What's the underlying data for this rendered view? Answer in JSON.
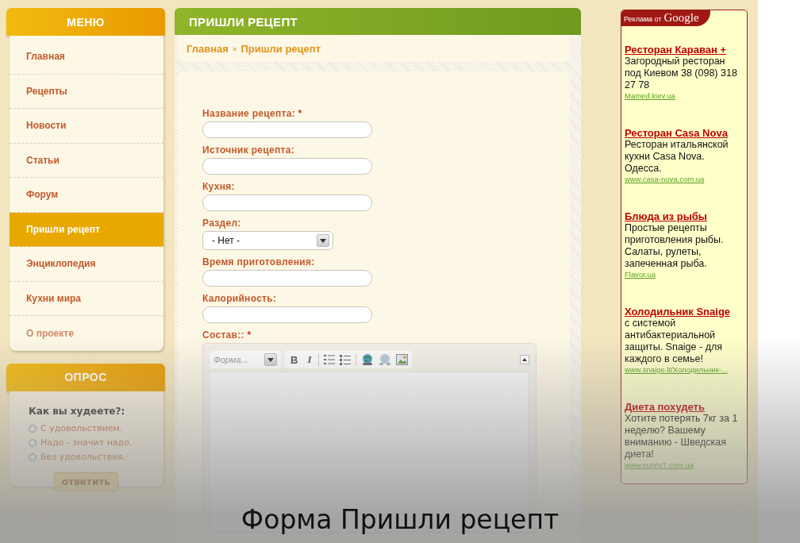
{
  "menu": {
    "title": "МЕНЮ",
    "items": [
      {
        "label": "Главная",
        "selected": false
      },
      {
        "label": "Рецепты",
        "selected": false
      },
      {
        "label": "Новости",
        "selected": false
      },
      {
        "label": "Статьи",
        "selected": false
      },
      {
        "label": "Форум",
        "selected": false
      },
      {
        "label": "Пришли рецепт",
        "selected": true
      },
      {
        "label": "Энциклопедия",
        "selected": false
      },
      {
        "label": "Кухни мира",
        "selected": false
      },
      {
        "label": "О проекте",
        "selected": false
      }
    ]
  },
  "poll": {
    "title": "ОПРОС",
    "question": "Как вы худеете?:",
    "options": [
      {
        "label": "С удовольствием.",
        "selected": false
      },
      {
        "label": "Надо - значит надо.",
        "selected": false
      },
      {
        "label": "Без удовольствия.",
        "selected": false
      }
    ],
    "button": "ответить"
  },
  "page": {
    "title": "ПРИШЛИ РЕЦЕПТ",
    "breadcrumb": [
      "Главная",
      "Пришли рецепт"
    ],
    "separator": "»"
  },
  "form": {
    "required_mark": "*",
    "fields": [
      {
        "kind": "text",
        "label": "Название рецепта:",
        "required": true
      },
      {
        "kind": "text",
        "label": "Источник рецепта:",
        "required": false
      },
      {
        "kind": "text",
        "label": "Кухня:",
        "required": false
      },
      {
        "kind": "select",
        "label": "Раздел:",
        "required": false,
        "value": "- Нет -"
      },
      {
        "kind": "text",
        "label": "Время приготовления:",
        "required": false
      },
      {
        "kind": "text",
        "label": "Калорийность:",
        "required": false
      },
      {
        "kind": "editor",
        "label": "Состав::",
        "required": true
      }
    ],
    "editor": {
      "format_placeholder": "Форма...",
      "bold": "B",
      "italic": "I"
    }
  },
  "ads": {
    "header": "Реклама от",
    "brand": "Google",
    "items": [
      {
        "title": "Ресторан Караван +",
        "text": "Загородный ресторан под Киевом 38 (098) 318 27 78",
        "url": "Mamed.kiev.ua"
      },
      {
        "title": "Ресторан Casa Nova",
        "text": "Ресторан итальянской кухни Casa Nova. Одесса.",
        "url": "www.casa-nova.com.ua"
      },
      {
        "title": "Блюда из рыбы",
        "text": "Простые рецепты приготовления рыбы. Салаты, рулеты, запеченная рыба.",
        "url": "Flavor.ua"
      },
      {
        "title": "Холодильник Snaige",
        "text": "с системой антибактериальной защиты. Snaige - для каждого в семье!",
        "url": "www.snaige.lt/Холодильник-..."
      },
      {
        "title": "Диета похудеть",
        "text": "Хотите потерять 7кг за 1 неделю? Вашему вниманию - Шведская диета!",
        "url": "www.sunny7.com.ua"
      }
    ]
  },
  "caption": "Форма Пришли рецепт"
}
